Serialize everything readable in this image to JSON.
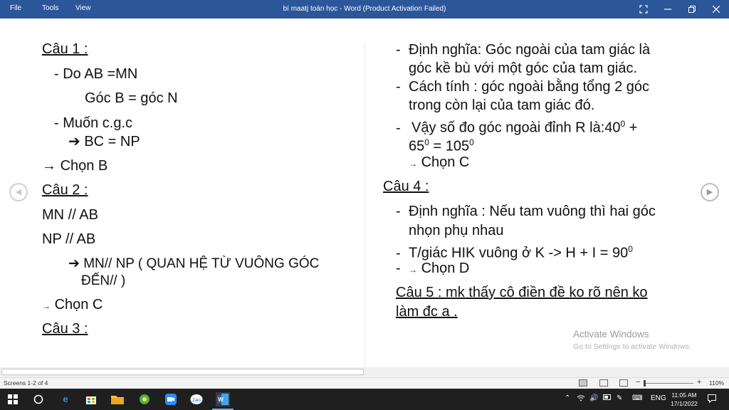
{
  "titlebar": {
    "menus": [
      "File",
      "Tools",
      "View"
    ],
    "title": "bí maatj toán học - Word (Product Activation Failed)"
  },
  "left_column": {
    "q1_heading": "Câu 1 :",
    "q1_line1": "-  Do  AB =MN",
    "q1_line2": "Góc B = góc N",
    "q1_line3": "-  Muốn c.g.c",
    "q1_line4": "BC = NP",
    "q1_line5": "Chọn B",
    "q2_heading": "Câu 2 :",
    "q2_line1": "MN // AB",
    "q2_line2": "NP // AB",
    "q2_line3": "MN// NP ( QUAN HỆ TỪ VUÔNG GÓC",
    "q2_line4": "ĐẾN// )",
    "q2_line5": "Chọn C",
    "q3_heading": "Câu 3 :"
  },
  "right_column": {
    "d1_line1": "Định nghĩa: Góc ngoài của tam giác là",
    "d1_line2": "góc kề bù với một góc của tam giác.",
    "d2_line1": "Cách tính : góc ngoài bằng tổng 2 góc",
    "d2_line2": "trong còn lại của tam giác đó.",
    "d3_line1_text": "Vậy số đo góc ngoài đỉnh R là:40",
    "d3_line1_sup": "0",
    "d3_line1_end": " +",
    "d3_line2_a": "65",
    "d3_line2_sup1": "0",
    "d3_line2_b": " = 105",
    "d3_line2_sup2": "0",
    "d3_choose": "Chọn C",
    "q4_heading": "Câu 4 :",
    "q4_line1": "Định nghĩa : Nếu tam vuông thì hai góc",
    "q4_line2": "nhọn phụ nhau",
    "q4_line3_text": "T/giác HIK vuông ở K -> H + I = 90",
    "q4_line3_sup": "0",
    "q4_choose": "Chọn D",
    "q5_line1": "Câu 5 : mk thấy cô điền đề ko rõ nên ko",
    "q5_line2": "làm đc a ."
  },
  "watermark": {
    "title": "Activate Windows",
    "subtitle": "Go to Settings to activate Windows."
  },
  "statusbar": {
    "pages": "Screens 1-2 of 4",
    "zoom": "110%"
  },
  "taskbar": {
    "language": "ENG",
    "time": "11:05 AM",
    "date": "17/1/2022"
  },
  "colors": {
    "titlebar": "#2b579a",
    "taskbar": "#1f1f1f"
  }
}
